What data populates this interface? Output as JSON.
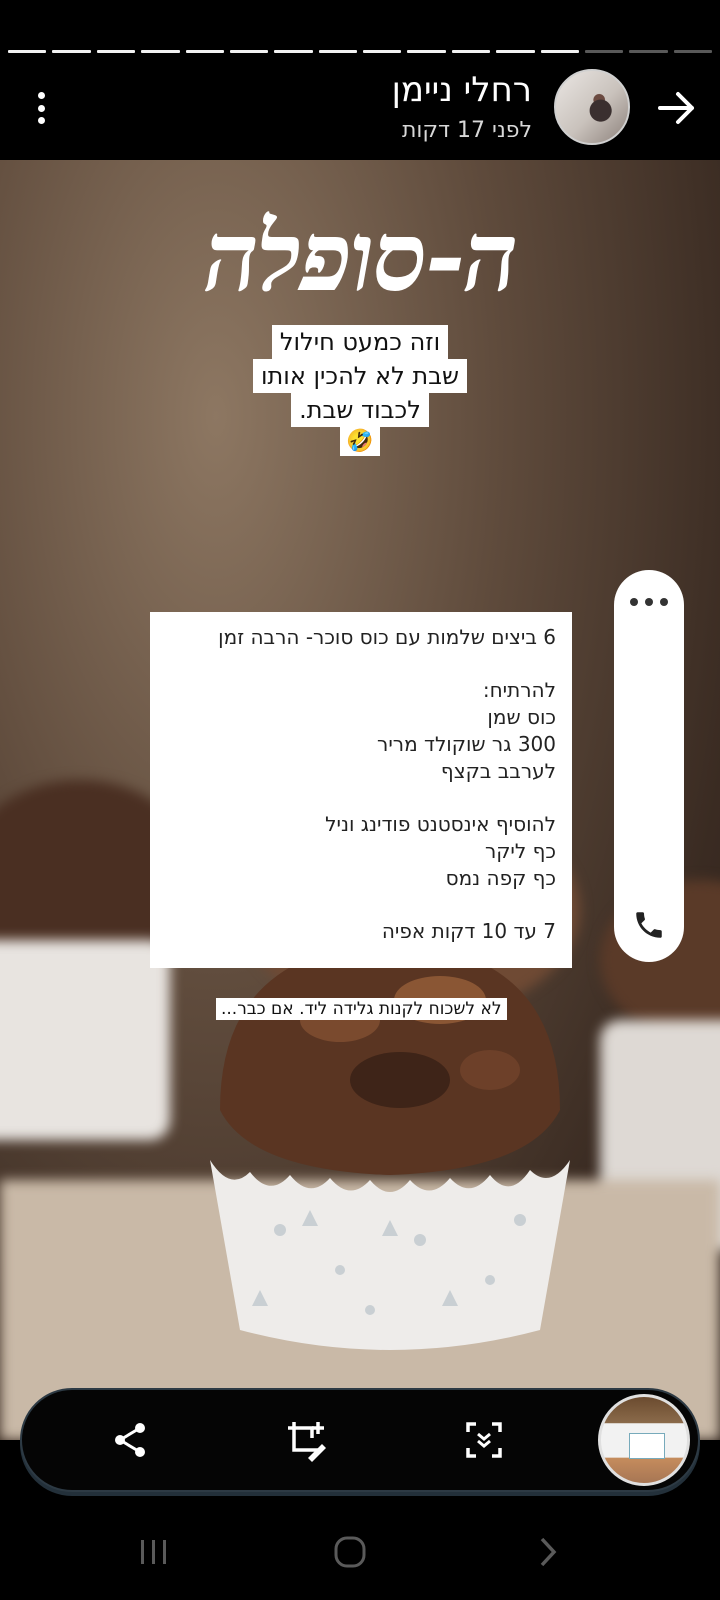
{
  "progress": {
    "total_segments": 16,
    "completed_segments": 13
  },
  "header": {
    "user_name": "רחלי ניימן",
    "time_ago": "לפני 17 דקות"
  },
  "story": {
    "title": "ה-סופלה",
    "subtitle_lines": [
      "וזה כמעט חילול",
      "שבת לא להכין אותו",
      "לכבוד שבת."
    ],
    "emoji": "🤣",
    "recipe": {
      "line1": "6 ביצים שלמות עם כוס סוכר- הרבה זמן",
      "line2": "להרתיח:",
      "line3": "כוס שמן",
      "line4": "300 גר שוקולד מריר",
      "line5": "לערבב בקצף",
      "line6": "להוסיף אינסטנט פודינג וניל",
      "line7": "כף ליקר",
      "line8": "כף קפה נמס",
      "line9": "7 עד 10 דקות אפיה"
    },
    "note": "לא לשכוח לקנות גלידה ליד. אם כבר..."
  },
  "colors": {
    "background": "#000000",
    "toolbar_border": "#2d3a44",
    "text_primary": "#ffffff"
  },
  "icons": {
    "menu": "more-vertical-icon",
    "back": "arrow-right-icon",
    "more": "more-horizontal-icon",
    "phone": "phone-icon",
    "share": "share-icon",
    "crop_edit": "crop-edit-icon",
    "scan": "scan-icon"
  }
}
